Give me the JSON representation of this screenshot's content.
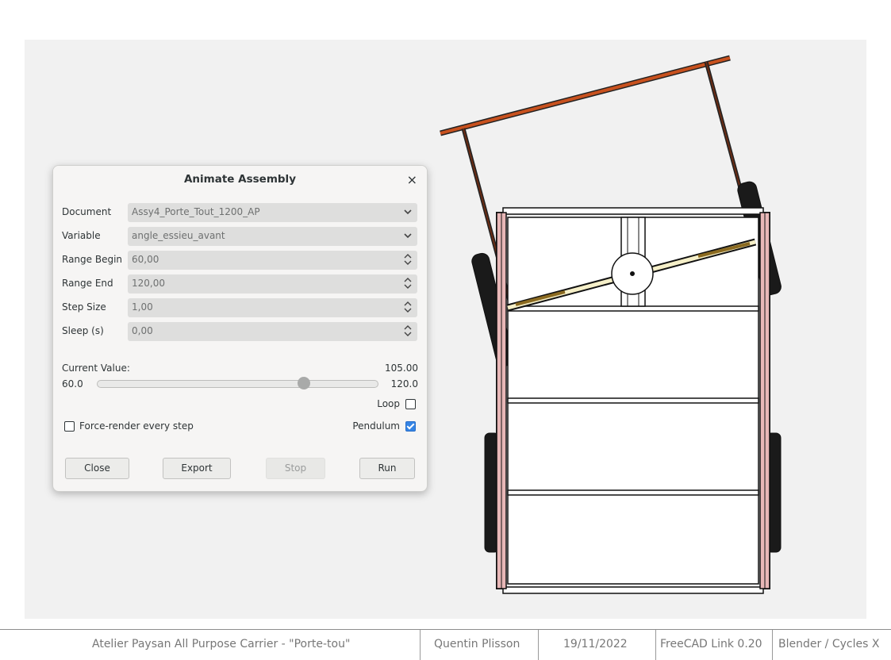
{
  "dialog": {
    "title": "Animate Assembly",
    "close_glyph": "×",
    "document_label": "Document",
    "document_value": "Assy4_Porte_Tout_1200_AP",
    "variable_label": "Variable",
    "variable_value": "angle_essieu_avant",
    "range_begin_label": "Range Begin",
    "range_begin_value": "60,00",
    "range_end_label": "Range End",
    "range_end_value": "120,00",
    "step_size_label": "Step Size",
    "step_size_value": "1,00",
    "sleep_label": "Sleep (s)",
    "sleep_value": "0,00",
    "current_value_label": "Current Value:",
    "current_value": "105.00",
    "slider_min": "60.0",
    "slider_max": "120.0",
    "slider_fraction": 0.75,
    "loop_label": "Loop",
    "loop_checked": false,
    "force_render_label": "Force-render every step",
    "force_render_checked": false,
    "pendulum_label": "Pendulum",
    "pendulum_checked": true,
    "buttons": {
      "close": "Close",
      "export": "Export",
      "stop": "Stop",
      "run": "Run"
    }
  },
  "footer": {
    "project": "Atelier Paysan All Purpose Carrier - \"Porte-tou\"",
    "author": "Quentin Plisson",
    "date": "19/11/2022",
    "cad": "FreeCAD Link 0.20",
    "renderer": "Blender / Cycles X"
  },
  "colors": {
    "viewport_bg": "#f1f1f1",
    "handle": "#c8511e",
    "frame_pink": "#e8b7b7",
    "accent": "#3584e4"
  }
}
